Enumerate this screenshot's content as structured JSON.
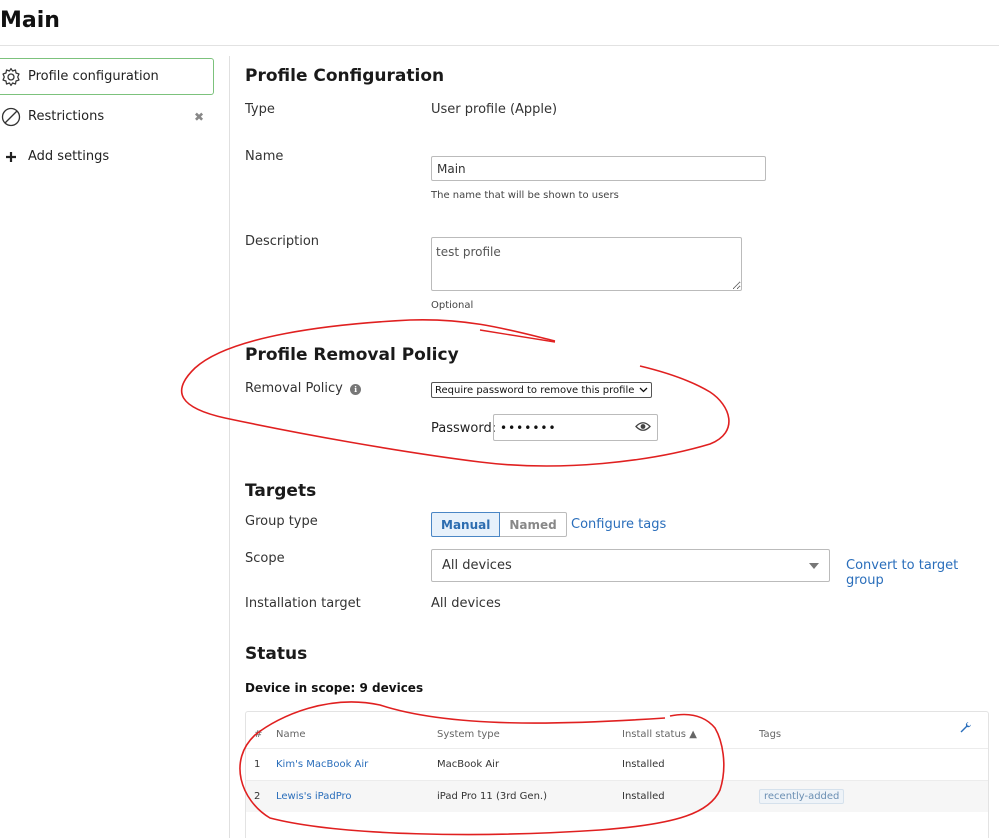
{
  "page": {
    "title": "Main"
  },
  "sidebar": {
    "items": [
      {
        "label": "Profile configuration",
        "icon": "gear-icon",
        "active": true
      },
      {
        "label": "Restrictions",
        "icon": "prohibited-icon",
        "removable": true
      },
      {
        "label": "Add settings",
        "icon": "plus-icon"
      }
    ],
    "remove_glyph": "✖"
  },
  "profile": {
    "heading": "Profile Configuration",
    "type_label": "Type",
    "type_value": "User profile (Apple)",
    "name_label": "Name",
    "name_value": "Main",
    "name_hint": "The name that will be shown to users",
    "description_label": "Description",
    "description_value": "test profile",
    "description_hint": "Optional"
  },
  "removal": {
    "heading": "Profile Removal Policy",
    "policy_label": "Removal Policy",
    "info_glyph": "ℹ",
    "policy_value": "Require password to remove this profile",
    "password_label": "Password:",
    "password_value": "•••••••"
  },
  "targets": {
    "heading": "Targets",
    "group_type_label": "Group type",
    "group_types": [
      "Manual",
      "Named"
    ],
    "selected_group_type": "Manual",
    "configure_tags_link": "Configure tags",
    "scope_label": "Scope",
    "scope_value": "All devices",
    "convert_link": "Convert to target group",
    "installation_target_label": "Installation target",
    "installation_target_value": "All devices"
  },
  "status": {
    "heading": "Status",
    "scope_count": "Device in scope: 9 devices",
    "columns": [
      "#",
      "Name",
      "System type",
      "Install status ▲",
      "Tags"
    ],
    "rows": [
      {
        "num": "1",
        "name": "Kim's MacBook Air",
        "system_type": "MacBook Air",
        "install_status": "Installed",
        "tags": ""
      },
      {
        "num": "2",
        "name": "Lewis's iPadPro",
        "system_type": "iPad Pro 11 (3rd Gen.)",
        "install_status": "Installed",
        "tags": "recently-added"
      }
    ]
  },
  "colors": {
    "active_border": "#7cc27c",
    "link": "#2a6ebb",
    "annotation": "#e02020"
  }
}
